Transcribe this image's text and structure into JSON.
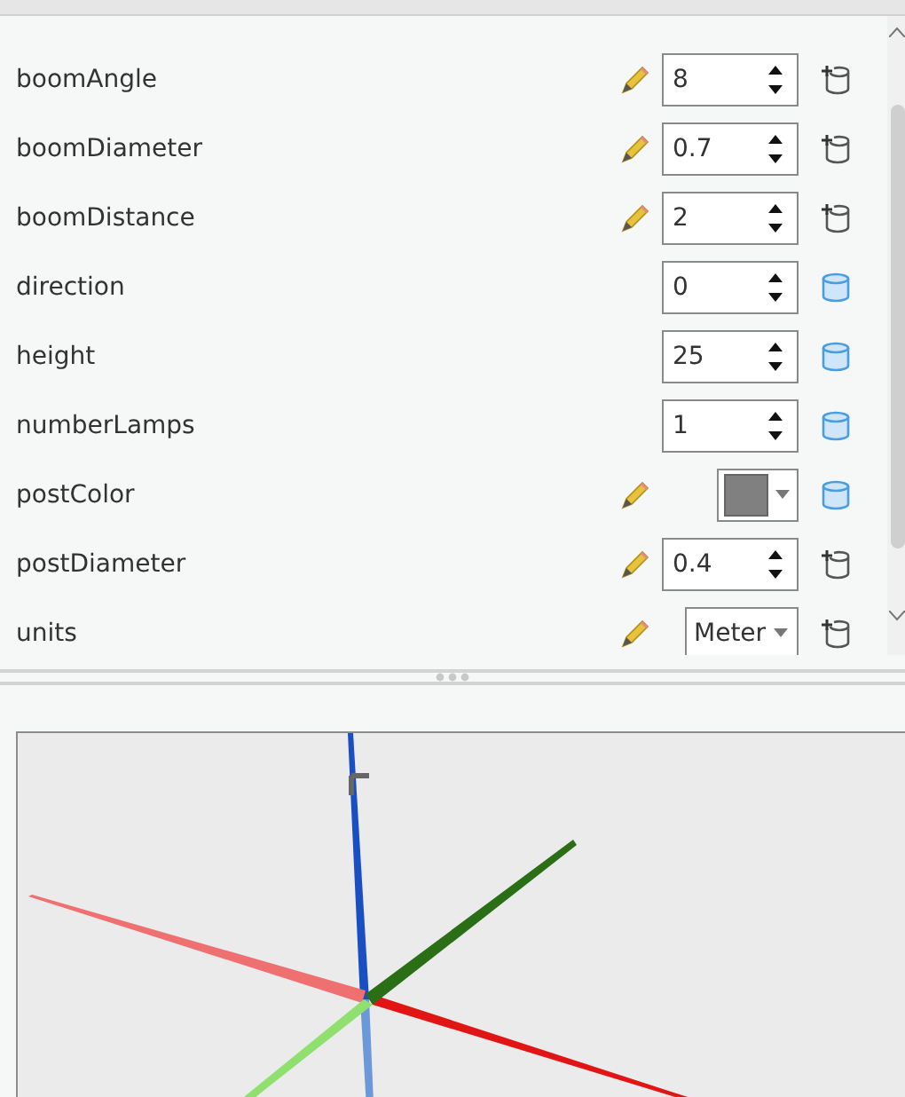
{
  "attributes": [
    {
      "name": "boomAngle",
      "editable": true,
      "kind": "spinner",
      "value": "8",
      "bound": false
    },
    {
      "name": "boomDiameter",
      "editable": true,
      "kind": "spinner",
      "value": "0.7",
      "bound": false
    },
    {
      "name": "boomDistance",
      "editable": true,
      "kind": "spinner",
      "value": "2",
      "bound": false
    },
    {
      "name": "direction",
      "editable": false,
      "kind": "spinner",
      "value": "0",
      "bound": true
    },
    {
      "name": "height",
      "editable": false,
      "kind": "spinner",
      "value": "25",
      "bound": true
    },
    {
      "name": "numberLamps",
      "editable": false,
      "kind": "spinner",
      "value": "1",
      "bound": true
    },
    {
      "name": "postColor",
      "editable": true,
      "kind": "color",
      "color": "#808080",
      "bound": true
    },
    {
      "name": "postDiameter",
      "editable": true,
      "kind": "spinner",
      "value": "0.4",
      "bound": false
    },
    {
      "name": "units",
      "editable": true,
      "kind": "dropdown",
      "value": "Meter",
      "bound": false
    }
  ]
}
